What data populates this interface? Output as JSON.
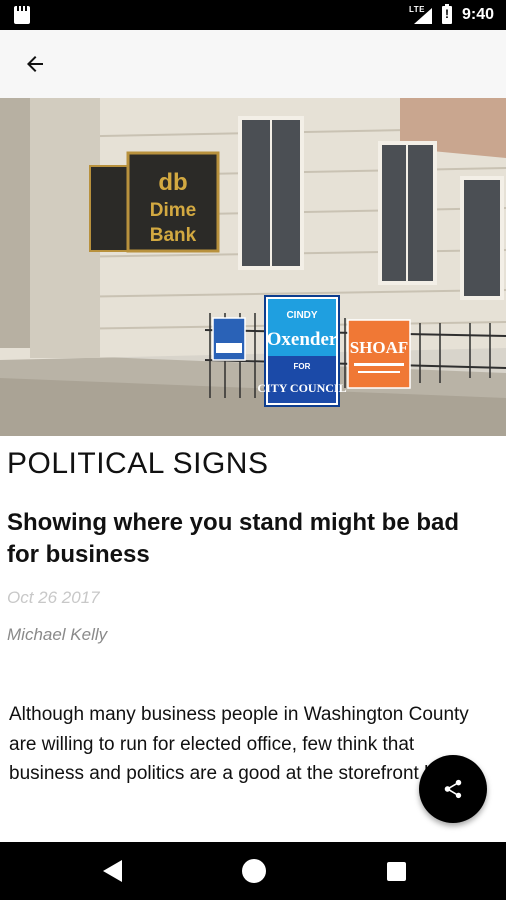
{
  "status_bar": {
    "network": "LTE",
    "time": "9:40",
    "icons": [
      "sd-card-icon",
      "signal-icon",
      "battery-alert-icon"
    ]
  },
  "app_bar": {
    "back_icon": "arrow-back-icon"
  },
  "hero_image": {
    "alt_signs": [
      "db Dime Bank",
      "CINDY Oxender FOR CITY COUNCIL",
      "SHOAF"
    ],
    "bank_sign": {
      "logo": "db",
      "line1": "Dime",
      "line2": "Bank"
    },
    "sign_oxender": {
      "first": "CINDY",
      "last": "Oxender",
      "for": "FOR",
      "office": "CITY COUNCIL"
    },
    "sign_shoaf": {
      "name": "SHOAF"
    }
  },
  "article": {
    "section": "POLITICAL SIGNS",
    "headline": "Showing where you stand might be bad for business",
    "date": "Oct 26 2017",
    "author": "Michael Kelly",
    "body": "Although many business people in Washington County are willing to run for elected office, few think that business and politics are a good at the storefront level."
  },
  "fab": {
    "icon": "share-icon"
  },
  "nav_bar": {
    "icons": [
      "nav-back-icon",
      "nav-home-icon",
      "nav-recents-icon"
    ]
  },
  "colors": {
    "status_bar": "#000000",
    "app_bar": "#f7f7f7",
    "date_text": "#c8c8c8",
    "author_text": "#8a8a8a",
    "fab": "#000000"
  }
}
